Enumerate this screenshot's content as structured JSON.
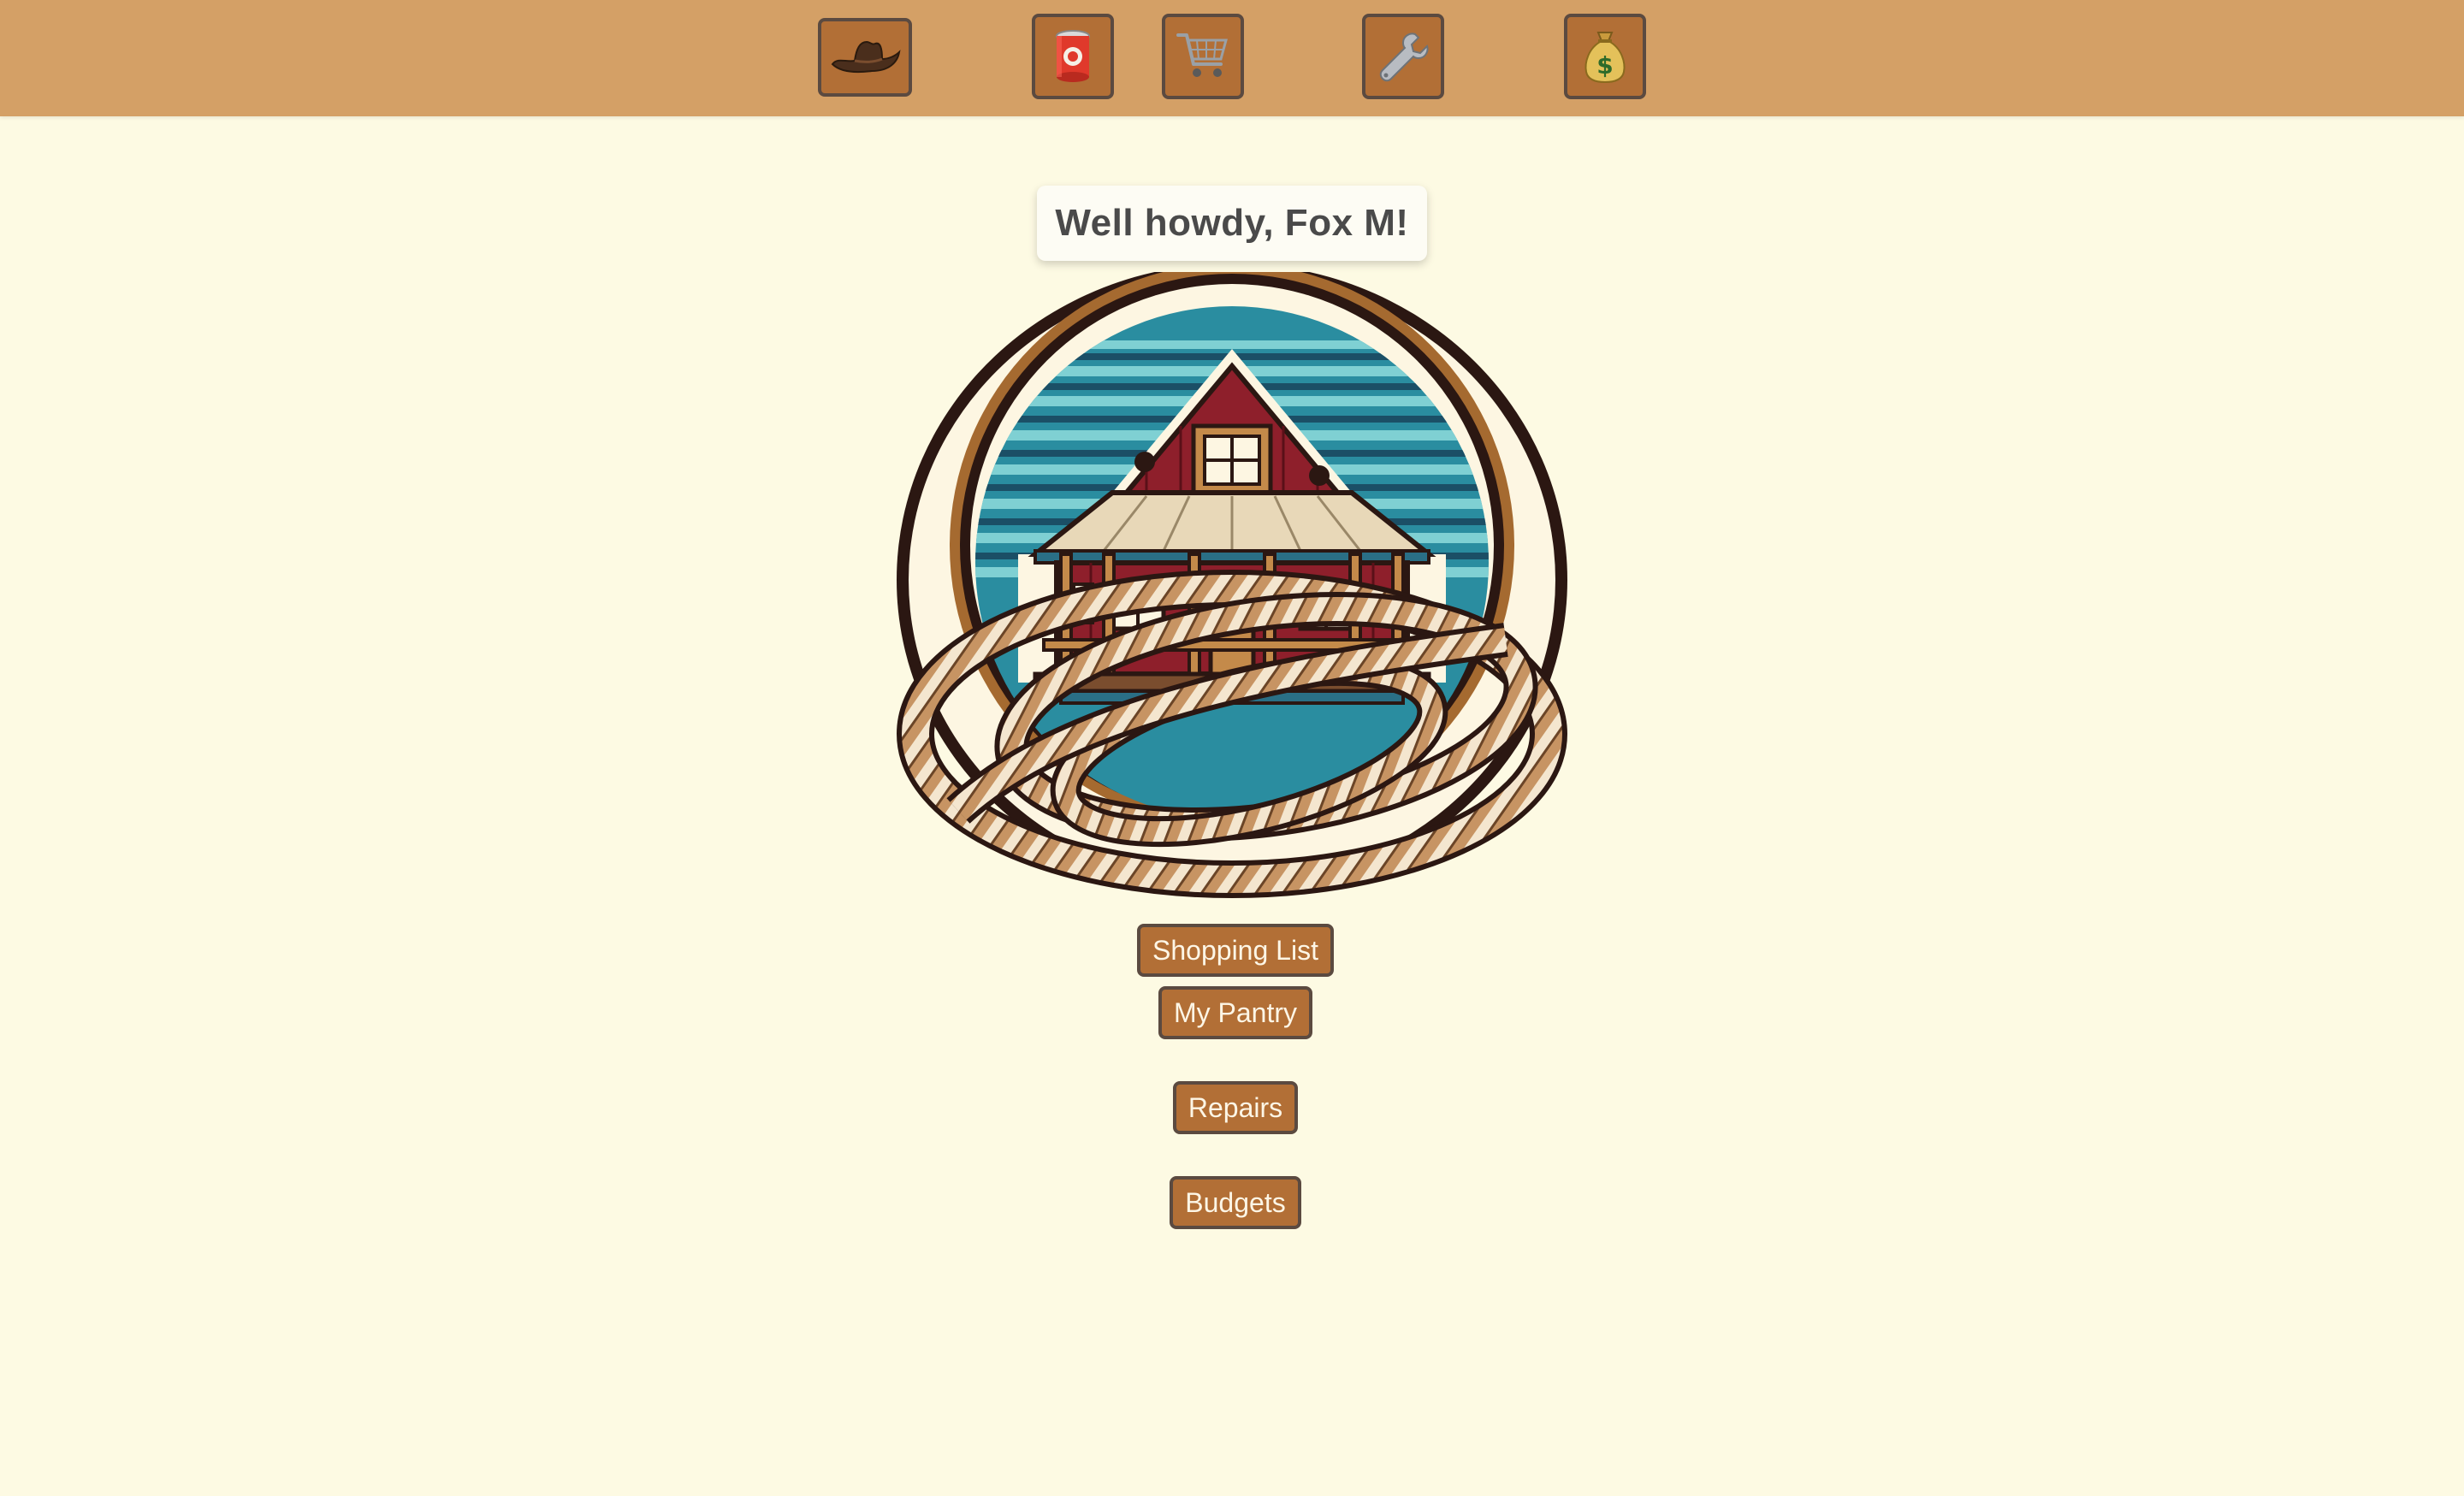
{
  "nav": {
    "items": [
      {
        "icon": "cowboy-hat-icon"
      },
      {
        "icon": "canned-food-icon"
      },
      {
        "icon": "shopping-cart-icon"
      },
      {
        "icon": "wrench-icon"
      },
      {
        "icon": "money-bag-icon"
      }
    ]
  },
  "greeting": {
    "text": "Well howdy, Fox M!"
  },
  "logo": {
    "icon": "ranch-house-lasso-logo"
  },
  "actions": {
    "shopping_list": "Shopping List",
    "my_pantry": "My Pantry",
    "repairs": "Repairs",
    "budgets": "Budgets"
  },
  "colors": {
    "topbar": "#d4a066",
    "background": "#fdfae3",
    "button": "#b26f36",
    "button_border": "#5b4a40",
    "button_text": "#fdf6e6",
    "greeting_text": "#4a4a4a"
  }
}
